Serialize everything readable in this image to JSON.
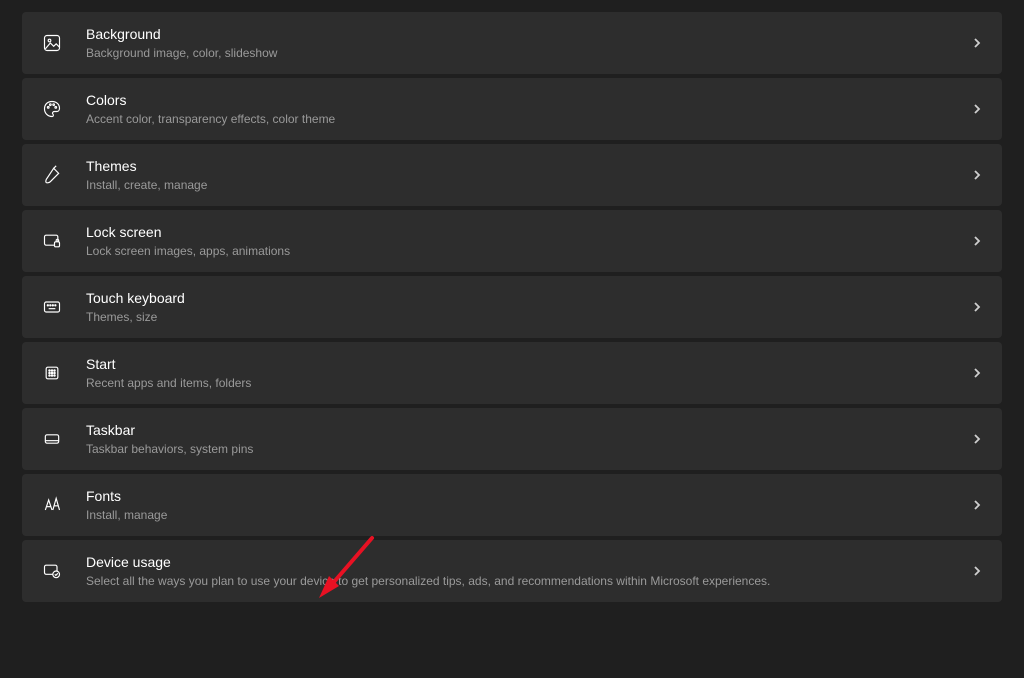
{
  "settings": {
    "background": {
      "title": "Background",
      "desc": "Background image, color, slideshow"
    },
    "colors": {
      "title": "Colors",
      "desc": "Accent color, transparency effects, color theme"
    },
    "themes": {
      "title": "Themes",
      "desc": "Install, create, manage"
    },
    "lockscreen": {
      "title": "Lock screen",
      "desc": "Lock screen images, apps, animations"
    },
    "touchkb": {
      "title": "Touch keyboard",
      "desc": "Themes, size"
    },
    "start": {
      "title": "Start",
      "desc": "Recent apps and items, folders"
    },
    "taskbar": {
      "title": "Taskbar",
      "desc": "Taskbar behaviors, system pins"
    },
    "fonts": {
      "title": "Fonts",
      "desc": "Install, manage"
    },
    "deviceusage": {
      "title": "Device usage",
      "desc": "Select all the ways you plan to use your device to get personalized tips, ads, and recommendations within Microsoft experiences."
    }
  },
  "annotation": {
    "arrow_color": "#E81123"
  }
}
